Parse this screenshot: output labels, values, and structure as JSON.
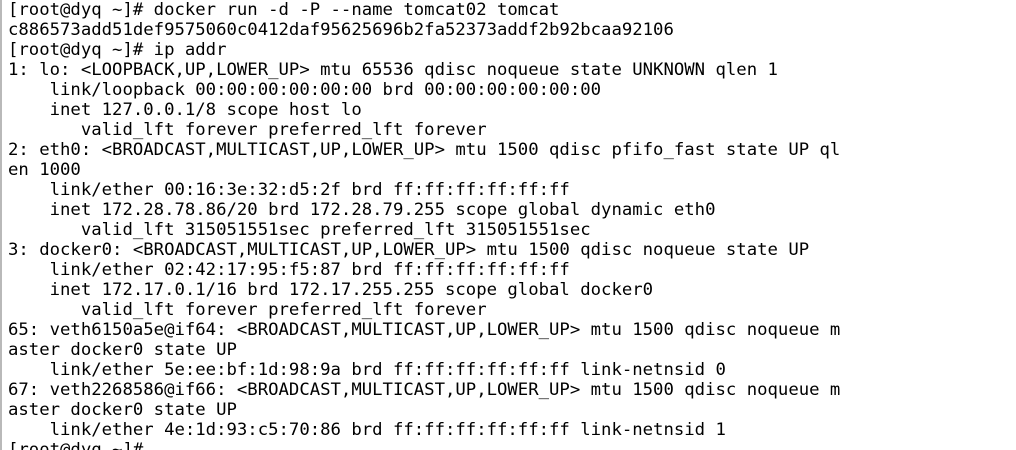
{
  "terminal": {
    "lines": [
      "[root@dyq ~]# docker run -d -P --name tomcat02 tomcat",
      "c886573add51def9575060c0412daf95625696b2fa52373addf2b92bcaa92106",
      "[root@dyq ~]# ip addr",
      "1: lo: <LOOPBACK,UP,LOWER_UP> mtu 65536 qdisc noqueue state UNKNOWN qlen 1",
      "    link/loopback 00:00:00:00:00:00 brd 00:00:00:00:00:00",
      "    inet 127.0.0.1/8 scope host lo",
      "       valid_lft forever preferred_lft forever",
      "2: eth0: <BROADCAST,MULTICAST,UP,LOWER_UP> mtu 1500 qdisc pfifo_fast state UP ql",
      "en 1000",
      "    link/ether 00:16:3e:32:d5:2f brd ff:ff:ff:ff:ff:ff",
      "    inet 172.28.78.86/20 brd 172.28.79.255 scope global dynamic eth0",
      "       valid_lft 315051551sec preferred_lft 315051551sec",
      "3: docker0: <BROADCAST,MULTICAST,UP,LOWER_UP> mtu 1500 qdisc noqueue state UP",
      "    link/ether 02:42:17:95:f5:87 brd ff:ff:ff:ff:ff:ff",
      "    inet 172.17.0.1/16 brd 172.17.255.255 scope global docker0",
      "       valid_lft forever preferred_lft forever",
      "65: veth6150a5e@if64: <BROADCAST,MULTICAST,UP,LOWER_UP> mtu 1500 qdisc noqueue m",
      "aster docker0 state UP",
      "    link/ether 5e:ee:bf:1d:98:9a brd ff:ff:ff:ff:ff:ff link-netnsid 0",
      "67: veth2268586@if66: <BROADCAST,MULTICAST,UP,LOWER_UP> mtu 1500 qdisc noqueue m",
      "aster docker0 state UP",
      "    link/ether 4e:1d:93:c5:70:86 brd ff:ff:ff:ff:ff:ff link-netnsid 1",
      "[root@dyq ~]#"
    ]
  }
}
